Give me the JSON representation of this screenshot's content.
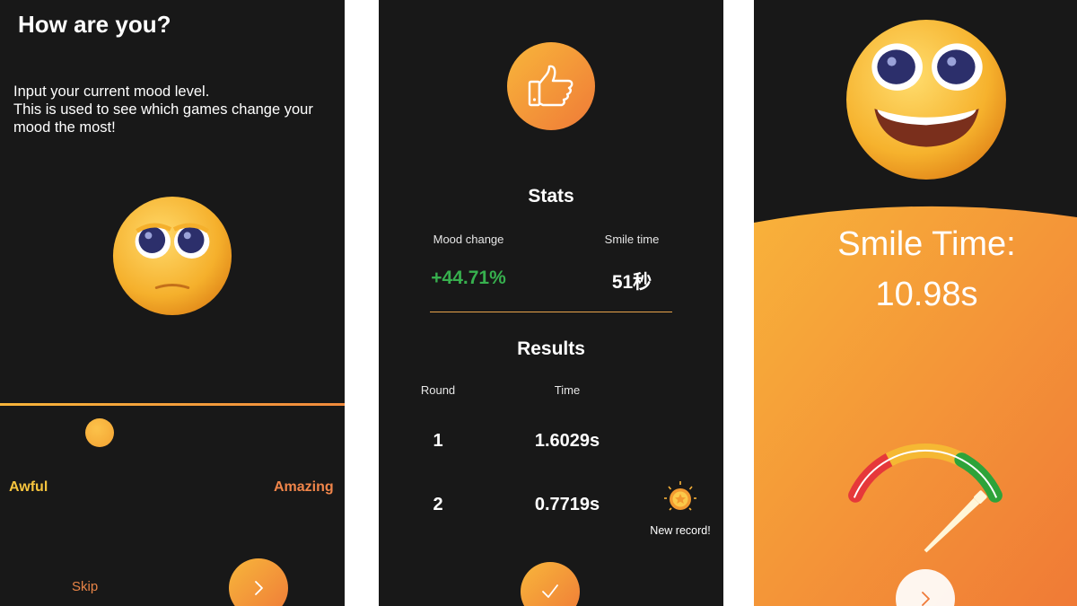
{
  "mood_input": {
    "title": "How are you?",
    "description_lines": [
      "Input your current mood level.",
      "This is used to see which games change your",
      "mood the most!"
    ],
    "slider": {
      "value": 0.29,
      "min_label": "Awful",
      "max_label": "Amazing"
    },
    "skip_label": "Skip",
    "next_icon": "chevron-right-icon"
  },
  "results": {
    "badge_icon": "thumbs-up-icon",
    "stats_heading": "Stats",
    "mood_change_label": "Mood change",
    "mood_change_value": "+44.71%",
    "smile_time_label": "Smile time",
    "smile_time_value": "51秒",
    "results_heading": "Results",
    "columns": [
      "Round",
      "Time"
    ],
    "rows": [
      {
        "round": "1",
        "time": "1.6029s"
      },
      {
        "round": "2",
        "time": "0.7719s"
      }
    ],
    "record_label": "New record!",
    "record_icon": "medal-icon",
    "done_icon": "checkmark-icon"
  },
  "smile": {
    "label": "Smile Time:",
    "value": "10.98s",
    "gauge_level": 0.85,
    "gauge_colors": [
      "#e6383a",
      "#f5b833",
      "#2ea33a"
    ],
    "next_icon": "chevron-right-icon"
  },
  "colors": {
    "accent_yellow": "#f8b63a",
    "accent_orange": "#ef7a38",
    "positive_green": "#37b04e",
    "background": "#181818"
  }
}
